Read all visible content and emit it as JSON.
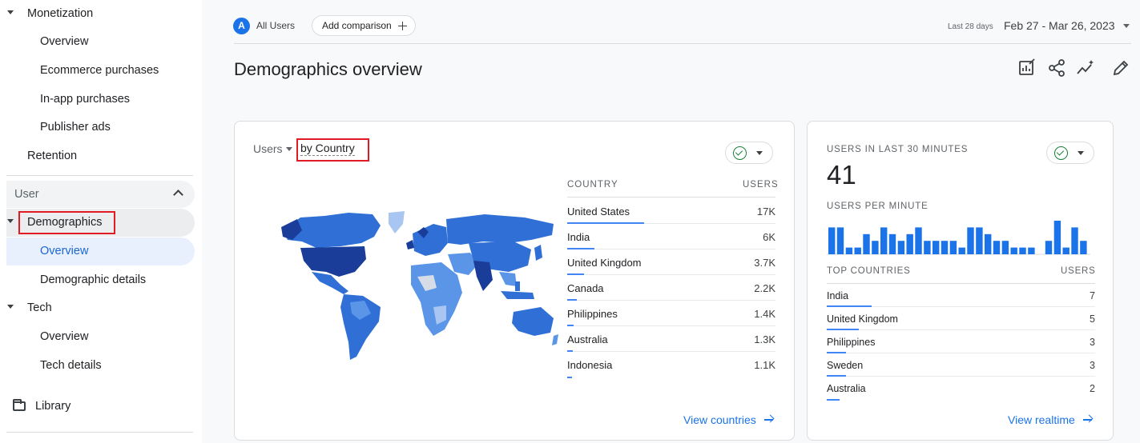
{
  "sidebar": {
    "items": [
      {
        "label": "Monetization",
        "level": "top",
        "expanded": true
      },
      {
        "label": "Overview",
        "level": "sub"
      },
      {
        "label": "Ecommerce purchases",
        "level": "sub"
      },
      {
        "label": "In-app purchases",
        "level": "sub"
      },
      {
        "label": "Publisher ads",
        "level": "sub"
      },
      {
        "label": "Retention",
        "level": "top"
      },
      {
        "label": "User",
        "level": "section"
      },
      {
        "label": "Demographics",
        "level": "top",
        "expanded": true
      },
      {
        "label": "Overview",
        "level": "sub",
        "active": true
      },
      {
        "label": "Demographic details",
        "level": "sub"
      },
      {
        "label": "Tech",
        "level": "top",
        "expanded": true
      },
      {
        "label": "Overview",
        "level": "sub"
      },
      {
        "label": "Tech details",
        "level": "sub"
      },
      {
        "label": "Library",
        "level": "footer",
        "icon": "folder-icon"
      }
    ]
  },
  "topbar": {
    "segment_avatar": "A",
    "segment_label": "All Users",
    "add_comparison": "Add comparison",
    "date_hint": "Last 28 days",
    "date_range": "Feb 27 - Mar 26, 2023"
  },
  "page": {
    "title": "Demographics overview",
    "tools": [
      "customize-report-icon",
      "share-icon",
      "insights-icon",
      "edit-icon"
    ]
  },
  "country_card": {
    "metric": "Users",
    "dimension": "by Country",
    "col_country": "COUNTRY",
    "col_users": "USERS",
    "rows": [
      {
        "name": "United States",
        "value": "17K",
        "share": 1.0
      },
      {
        "name": "India",
        "value": "6K",
        "share": 0.35
      },
      {
        "name": "United Kingdom",
        "value": "3.7K",
        "share": 0.22
      },
      {
        "name": "Canada",
        "value": "2.2K",
        "share": 0.13
      },
      {
        "name": "Philippines",
        "value": "1.4K",
        "share": 0.08
      },
      {
        "name": "Australia",
        "value": "1.3K",
        "share": 0.076
      },
      {
        "name": "Indonesia",
        "value": "1.1K",
        "share": 0.065
      }
    ],
    "link": "View countries",
    "map_colors": {
      "high": "#1a3d99",
      "mid": "#2f6fd6",
      "low": "#5b95e8",
      "lighter": "#a9c6f3",
      "none": "#d7dde6"
    }
  },
  "realtime_card": {
    "label_users": "USERS IN LAST 30 MINUTES",
    "users": "41",
    "label_per_minute": "USERS PER MINUTE",
    "per_minute": [
      4,
      4,
      1,
      1,
      3,
      2,
      4,
      3,
      2,
      3,
      4,
      2,
      2,
      2,
      2,
      1,
      4,
      4,
      3,
      2,
      2,
      1,
      1,
      1,
      0,
      2,
      5,
      1,
      4,
      2
    ],
    "col_countries": "TOP COUNTRIES",
    "col_users": "USERS",
    "rows": [
      {
        "name": "India",
        "value": "7",
        "share": 1.0
      },
      {
        "name": "United Kingdom",
        "value": "5",
        "share": 0.71
      },
      {
        "name": "Philippines",
        "value": "3",
        "share": 0.43
      },
      {
        "name": "Sweden",
        "value": "3",
        "share": 0.43
      },
      {
        "name": "Australia",
        "value": "2",
        "share": 0.29
      }
    ],
    "link": "View realtime"
  },
  "accent": "#1a73e8",
  "highlight": "#e01b24"
}
